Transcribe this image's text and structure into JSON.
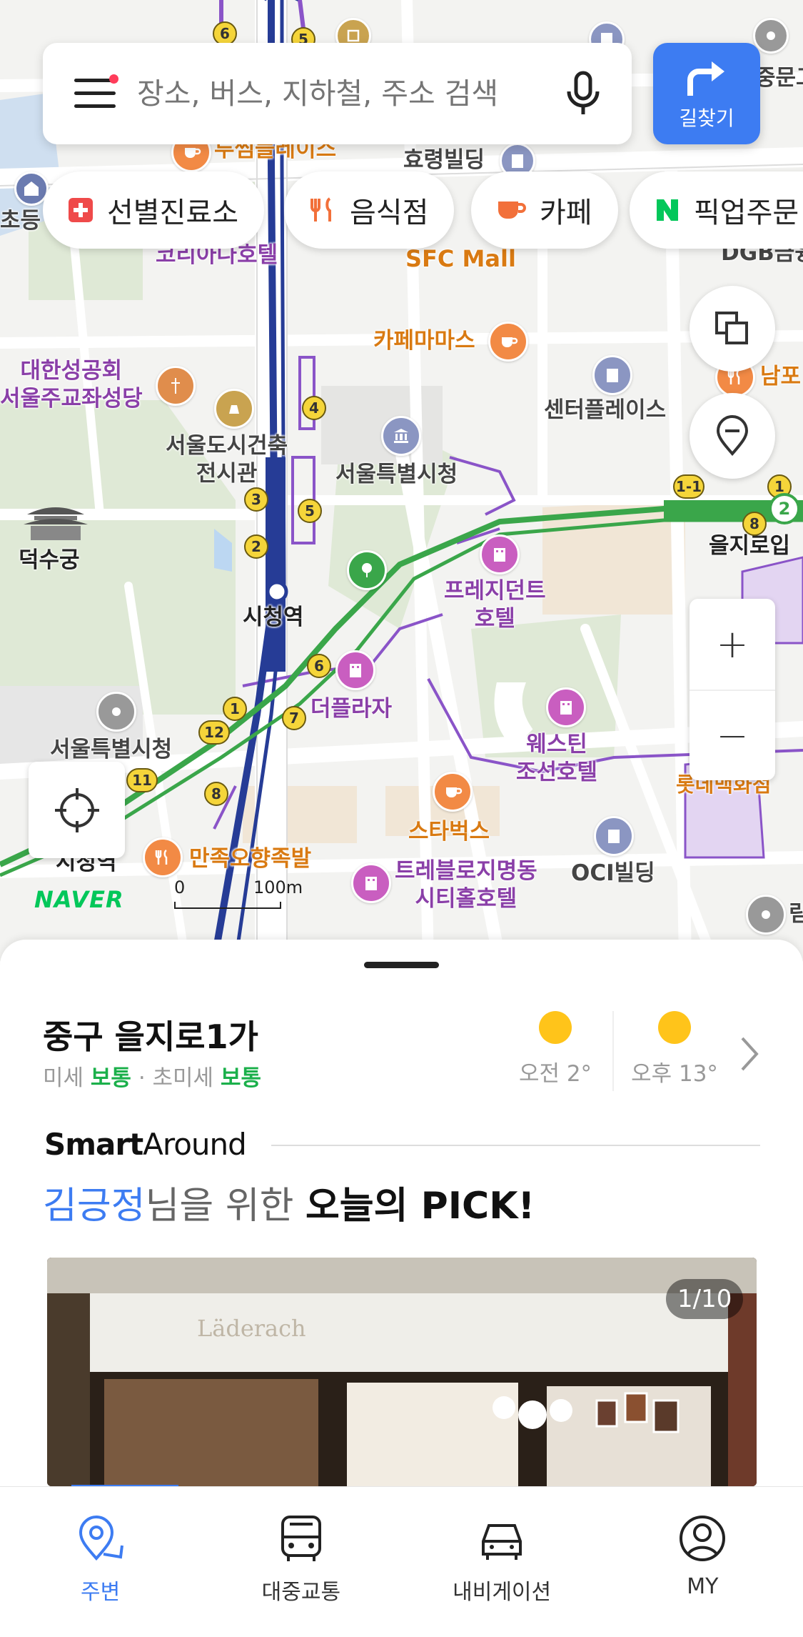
{
  "search": {
    "placeholder": "장소, 버스, 지하철, 주소 검색",
    "route_label": "길찾기"
  },
  "chips": [
    {
      "label": "선별진료소",
      "icon": "clinic-cross-icon"
    },
    {
      "label": "음식점",
      "icon": "restaurant-icon"
    },
    {
      "label": "카페",
      "icon": "cafe-cup-icon"
    },
    {
      "label": "픽업주문",
      "icon": "naver-n-icon"
    }
  ],
  "map": {
    "labels": {
      "twosome": "투썸플레이스",
      "hyoryeong": "효령빌딩",
      "school": "초등",
      "koreana": "코리아나호텔",
      "sfc": "SFC Mall",
      "dgb": "DGB금융",
      "cafe_mama": "카페마마스",
      "anglican": "대한성공회\n서울주교좌성당",
      "center_place": "센터플레이스",
      "nampo": "남포",
      "architecture": "서울도시건축\n전시관",
      "city_hall": "서울특별시청",
      "deoksugung": "덕수궁",
      "euljiro_station": "을지로입",
      "president": "프레지던트\n호텔",
      "city_hall_station": "시청역",
      "plaza": "더플라자",
      "westin": "웨스틴\n조선호텔",
      "lotte": "롯데백화점",
      "city_hall_west": "서울특별시청",
      "starbucks": "스타벅스",
      "manjok": "만족오향족발",
      "oci": "OCI빌딩",
      "travelodge": "트레블로지명동\n시티홀호텔",
      "sicheong_stub": "시청역",
      "mungo": "중문고",
      "rim": "림"
    },
    "exits": [
      "6",
      "5",
      "4",
      "3",
      "5",
      "2",
      "1-1",
      "1",
      "2",
      "8",
      "6",
      "1",
      "12",
      "7",
      "11",
      "8"
    ],
    "scale": {
      "zero": "0",
      "distance": "100m"
    },
    "brand": "NAVER",
    "zoom_in": "+",
    "zoom_out": "−"
  },
  "sheet": {
    "area_name": "중구 을지로1가",
    "dust_label": "미세",
    "dust_value": "보통",
    "fine_dust_label": "· 초미세",
    "fine_dust_value": "보통",
    "weather": [
      {
        "label": "오전 2°"
      },
      {
        "label": "오후 13°"
      }
    ],
    "smart_around_bold": "Smart",
    "smart_around_rest": "Around",
    "pick_name": "김긍정",
    "pick_middle": "님을 위한 ",
    "pick_bold": "오늘의 PICK!",
    "card_counter": "1/10",
    "card_store_sign": "Läderach"
  },
  "nav": [
    {
      "label": "주변",
      "icon": "location-pin-icon",
      "active": true
    },
    {
      "label": "대중교통",
      "icon": "bus-icon",
      "active": false
    },
    {
      "label": "내비게이션",
      "icon": "car-icon",
      "active": false
    },
    {
      "label": "MY",
      "icon": "user-circle-icon",
      "active": false
    }
  ],
  "colors": {
    "accent": "#3d7cf2",
    "line2_green": "#3aa64a",
    "line1_navy": "#263c96",
    "good_status": "#1bb04b"
  }
}
